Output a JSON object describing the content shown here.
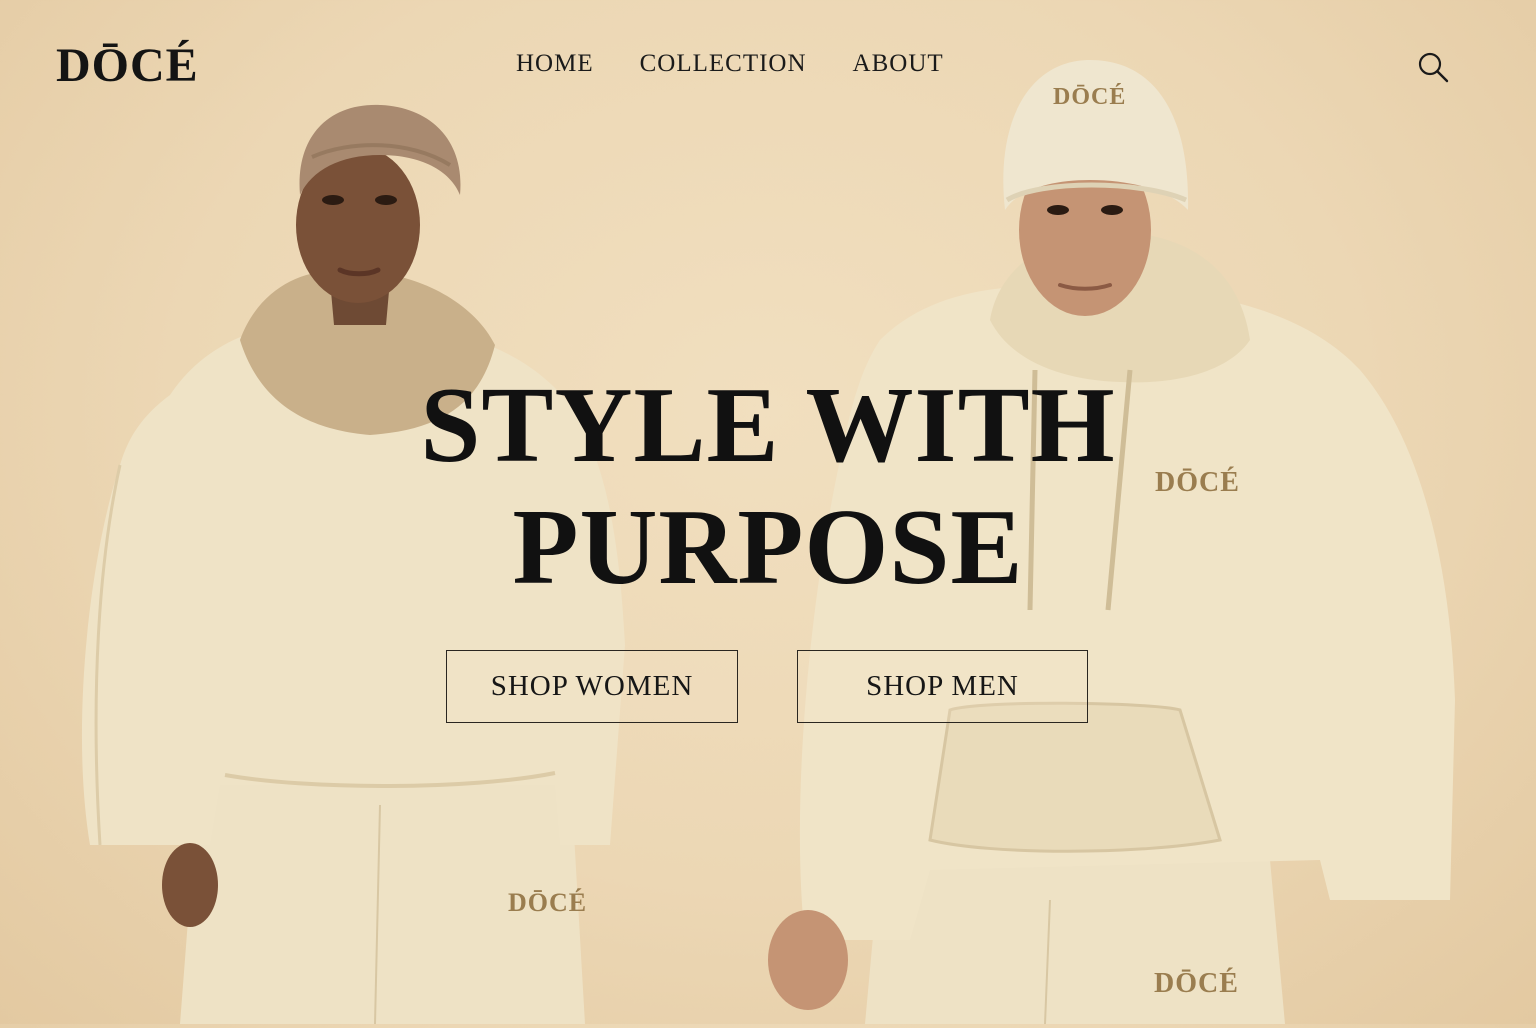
{
  "brand": {
    "logo_text": "DŌCÉ"
  },
  "nav": {
    "items": [
      {
        "label": "HOME"
      },
      {
        "label": "COLLECTION"
      },
      {
        "label": "ABOUT"
      }
    ]
  },
  "icons": {
    "search": "search-icon"
  },
  "hero": {
    "headline_line1": "STYLE WITH",
    "headline_line2": "PURPOSE",
    "buttons": [
      {
        "label": "SHOP WOMEN"
      },
      {
        "label": "SHOP MEN"
      }
    ]
  },
  "apparel_branding": {
    "beanie": "DŌCÉ",
    "hoodie_chest": "DŌCÉ",
    "woman_pants": "DŌCÉ",
    "man_pants": "DŌCÉ"
  },
  "colors": {
    "background": "#ecd7b4",
    "text": "#121212",
    "apparel": "#efe3c6",
    "emblem": "#9a7d4f"
  }
}
